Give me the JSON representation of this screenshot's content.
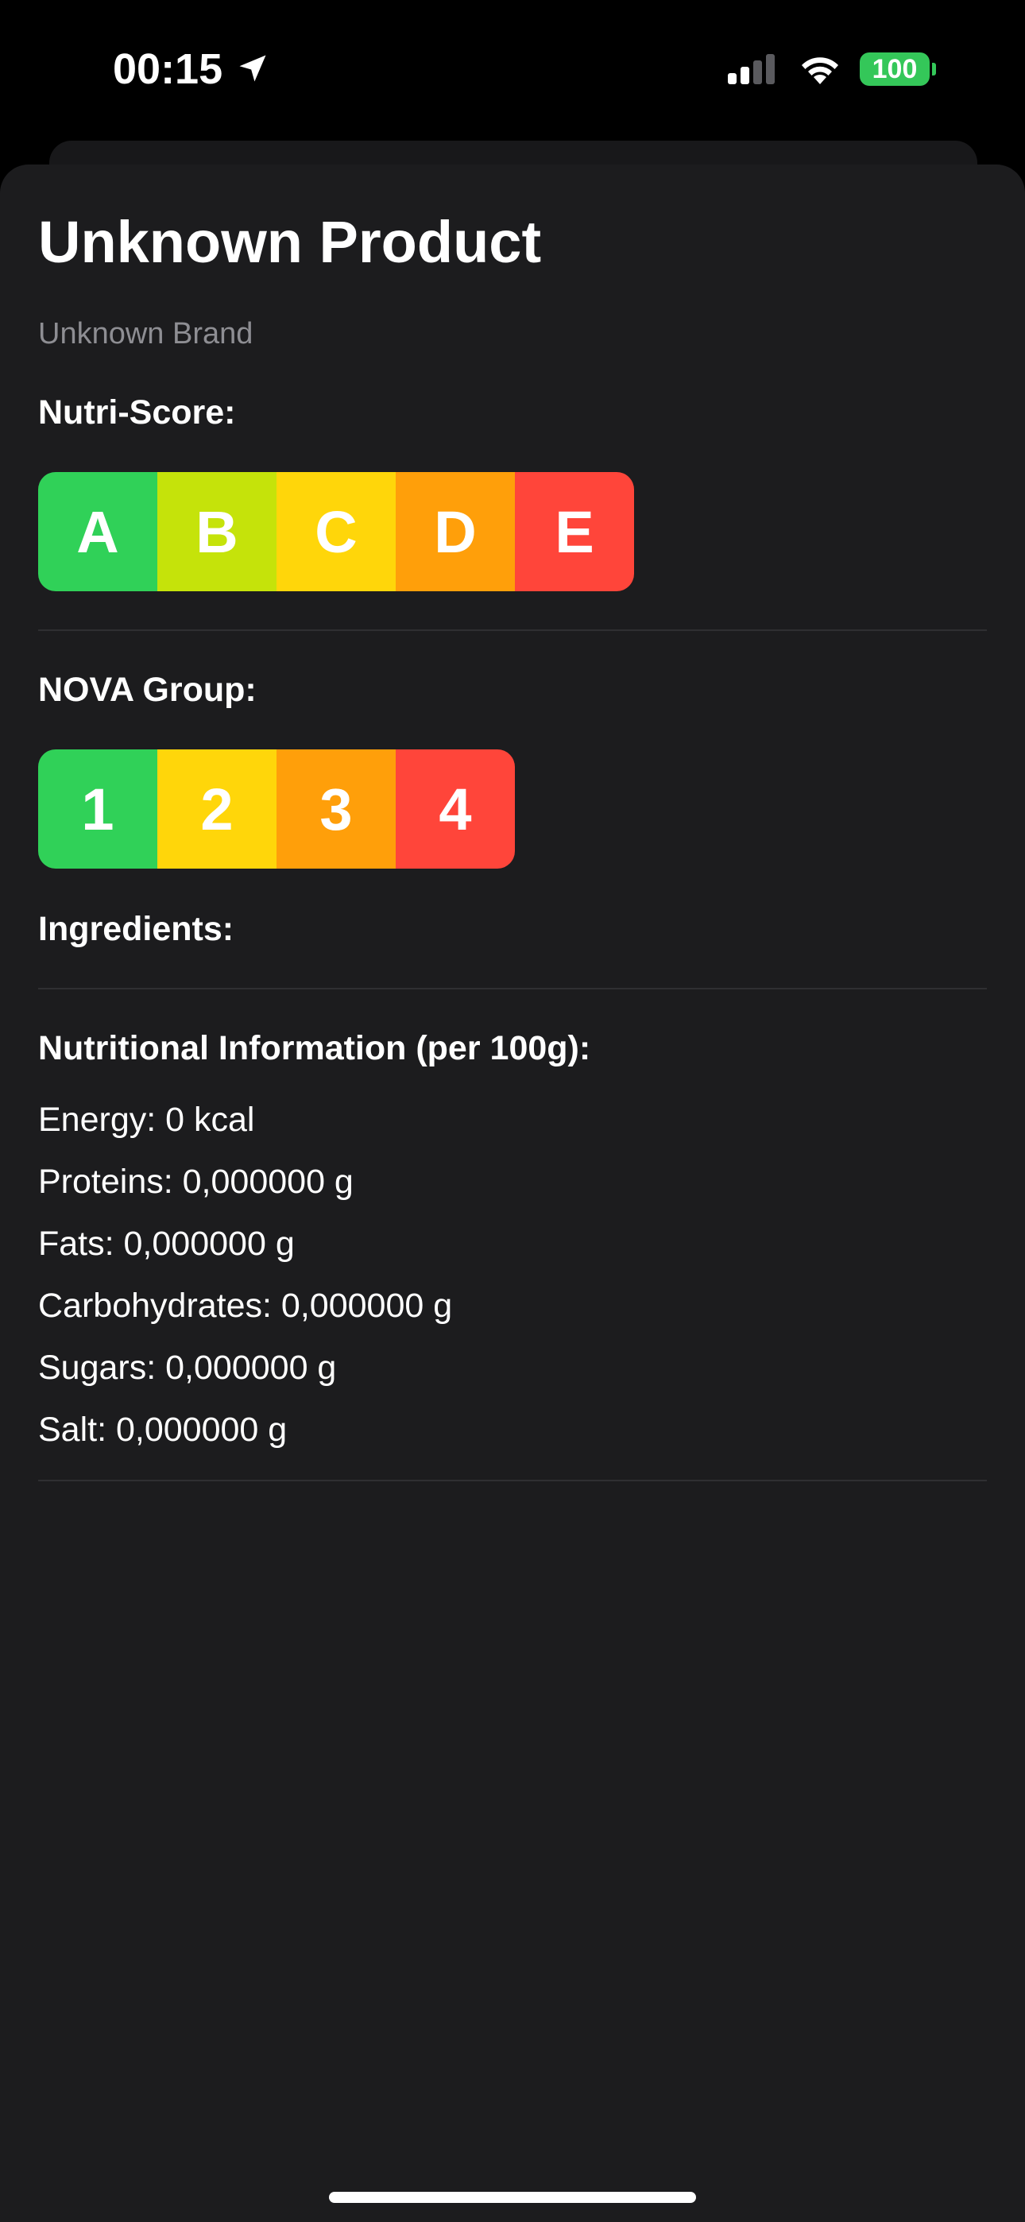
{
  "status_bar": {
    "time": "00:15",
    "battery": "100",
    "icons": [
      "location-arrow-icon",
      "cellular-signal-icon",
      "wifi-icon",
      "battery-icon"
    ]
  },
  "product": {
    "title": "Unknown Product",
    "brand": "Unknown Brand"
  },
  "nutri_score": {
    "label": "Nutri-Score:",
    "grades": [
      {
        "letter": "A",
        "color": "#30d158"
      },
      {
        "letter": "B",
        "color": "#c5e30a"
      },
      {
        "letter": "C",
        "color": "#ffd60a"
      },
      {
        "letter": "D",
        "color": "#ff9f0a"
      },
      {
        "letter": "E",
        "color": "#ff453a"
      }
    ]
  },
  "nova": {
    "label": "NOVA Group:",
    "groups": [
      {
        "number": "1",
        "color": "#30d158"
      },
      {
        "number": "2",
        "color": "#ffd60a"
      },
      {
        "number": "3",
        "color": "#ff9f0a"
      },
      {
        "number": "4",
        "color": "#ff453a"
      }
    ]
  },
  "ingredients": {
    "label": "Ingredients:"
  },
  "nutrition": {
    "title": "Nutritional Information (per 100g):",
    "items": [
      "Energy: 0 kcal",
      "Proteins: 0,000000 g",
      "Fats: 0,000000 g",
      "Carbohydrates: 0,000000 g",
      "Sugars: 0,000000 g",
      "Salt: 0,000000 g"
    ]
  },
  "colors": {
    "background": "#000000",
    "sheet": "#1c1c1e",
    "secondary_text": "#8e8e93",
    "battery": "#34c759"
  }
}
